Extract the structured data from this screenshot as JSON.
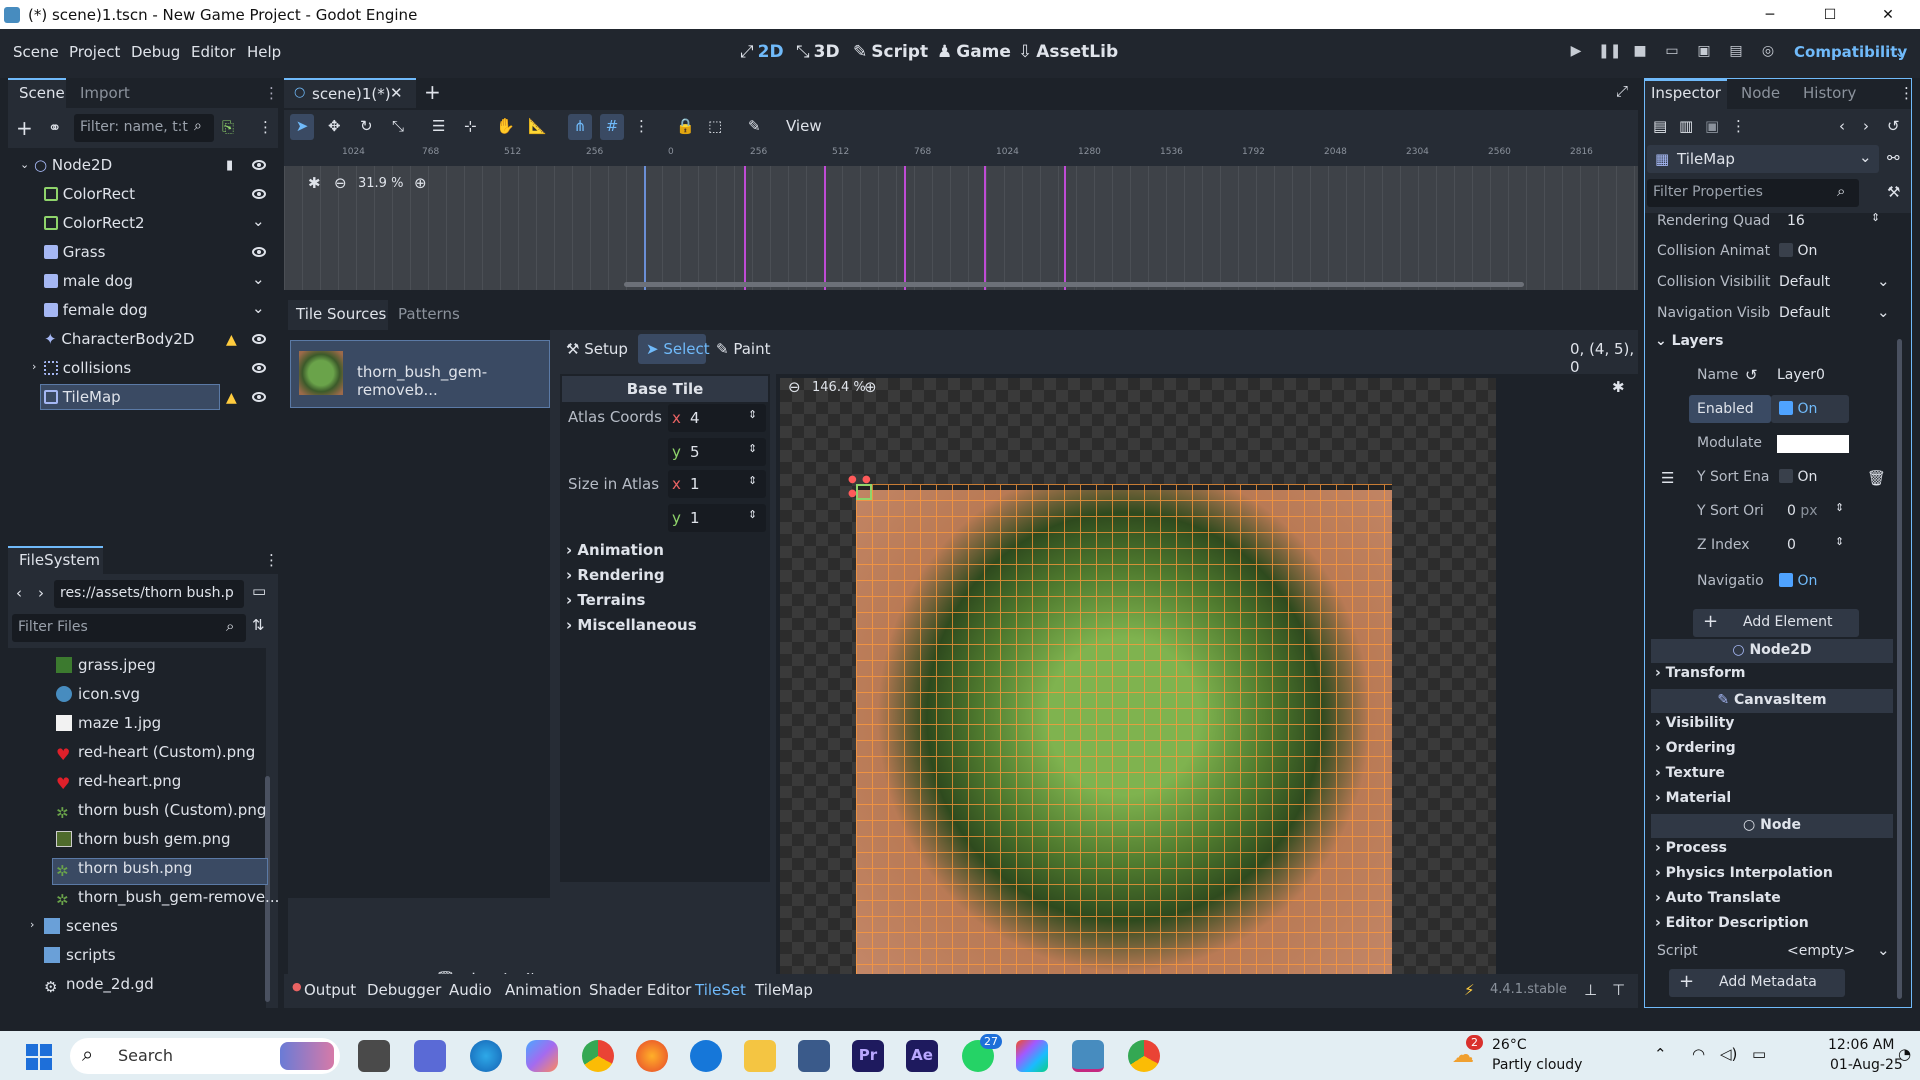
{
  "window": {
    "title": "(*) scene)1.tscn - New Game Project - Godot Engine",
    "minimize": "─",
    "maximize": "☐",
    "close": "✕"
  },
  "menu": {
    "items": [
      "Scene",
      "Project",
      "Debug",
      "Editor",
      "Help"
    ]
  },
  "workspaces": [
    {
      "label": "2D",
      "icon": "2d-icon",
      "active": true
    },
    {
      "label": "3D",
      "icon": "3d-icon",
      "active": false
    },
    {
      "label": "Script",
      "icon": "script-icon",
      "active": false
    },
    {
      "label": "Game",
      "icon": "game-icon",
      "active": false
    },
    {
      "label": "AssetLib",
      "icon": "assetlib-icon",
      "active": false
    }
  ],
  "renderer": "Compatibility",
  "scene_dock": {
    "tabs": [
      "Scene",
      "Import"
    ],
    "filter_placeholder": "Filter: name, t:t",
    "tree": [
      {
        "name": "Node2D",
        "icon": "node2d-icon"
      },
      {
        "name": "ColorRect",
        "icon": "colorrect-icon"
      },
      {
        "name": "ColorRect2",
        "icon": "colorrect-icon"
      },
      {
        "name": "Grass",
        "icon": "sprite-icon"
      },
      {
        "name": "male dog",
        "icon": "sprite-icon"
      },
      {
        "name": "female dog",
        "icon": "sprite-icon"
      },
      {
        "name": "CharacterBody2D",
        "icon": "characterbody-icon"
      },
      {
        "name": "collisions",
        "icon": "node2d-icon"
      },
      {
        "name": "TileMap",
        "icon": "tilemap-icon"
      }
    ]
  },
  "filesystem": {
    "tab": "FileSystem",
    "path": "res://assets/thorn bush.p",
    "filter_placeholder": "Filter Files",
    "items": [
      "grass.jpeg",
      "icon.svg",
      "maze 1.jpg",
      "red-heart (Custom).png",
      "red-heart.png",
      "thorn bush (Custom).png",
      "thorn bush gem.png",
      "thorn bush.png",
      "thorn_bush_gem-remove...",
      "scenes",
      "scripts",
      "node_2d.gd"
    ]
  },
  "editor": {
    "scene_tab": "scene)1(*)",
    "view_menu": "View",
    "zoom": "31.9 %",
    "ruler_ticks": [
      "1024",
      "768",
      "512",
      "256",
      "0",
      "256",
      "512",
      "768",
      "1024",
      "1280",
      "1536",
      "1792",
      "2048",
      "2304",
      "2560",
      "2816"
    ]
  },
  "tileset": {
    "tabs": [
      "Tile Sources",
      "Patterns"
    ],
    "source_name": "thorn_bush_gem-removeb...",
    "modes": [
      "Setup",
      "Select",
      "Paint"
    ],
    "coords": "0, (4, 5), 0",
    "atlas_zoom": "146.4 %",
    "base_tile": "Base Tile",
    "atlas_coords_label": "Atlas Coords",
    "atlas_x": "4",
    "atlas_y": "5",
    "size_label": "Size in Atlas",
    "size_x": "1",
    "size_y": "1",
    "axis_x": "x",
    "axis_y": "y",
    "sections": [
      "Animation",
      "Rendering",
      "Terrains",
      "Miscellaneous"
    ]
  },
  "bottom_bar": {
    "tabs": [
      "Output",
      "Debugger",
      "Audio",
      "Animation",
      "Shader Editor",
      "TileSet",
      "TileMap"
    ],
    "version": "4.4.1.stable"
  },
  "inspector": {
    "tabs": [
      "Inspector",
      "Node",
      "History"
    ],
    "object": "TileMap",
    "filter_placeholder": "Filter Properties",
    "props": [
      {
        "label": "Rendering Quad",
        "value": "16"
      },
      {
        "label": "Collision Animat",
        "value": "On"
      },
      {
        "label": "Collision Visibilit",
        "value": "Default"
      },
      {
        "label": "Navigation Visib",
        "value": "Default"
      }
    ],
    "layers_section": "Layers",
    "layer": {
      "name_label": "Name",
      "name_value": "Layer0",
      "enabled_label": "Enabled",
      "enabled_value": "On",
      "modulate_label": "Modulate",
      "ysort_label": "Y Sort Ena",
      "ysort_value": "On",
      "ysort_origin_label": "Y Sort Ori",
      "ysort_origin_value": "0",
      "ysort_origin_unit": "px",
      "zindex_label": "Z Index",
      "zindex_value": "0",
      "nav_label": "Navigatio",
      "nav_value": "On"
    },
    "add_element": "Add Element",
    "node2d_header": "Node2D",
    "transform": "Transform",
    "canvasitem_header": "CanvasItem",
    "canvas_sections": [
      "Visibility",
      "Ordering",
      "Texture",
      "Material"
    ],
    "node_header": "Node",
    "node_sections": [
      "Process",
      "Physics Interpolation",
      "Auto Translate",
      "Editor Description"
    ],
    "script_label": "Script",
    "script_value": "<empty>",
    "add_metadata": "Add Metadata"
  },
  "taskbar": {
    "search": "Search",
    "weather_temp": "26°C",
    "weather_desc": "Partly cloudy",
    "weather_badge": "2",
    "whatsapp_badge": "27",
    "time": "12:06 AM",
    "date": "01-Aug-25"
  },
  "colors": {
    "accent": "#70bafa",
    "selection": "#3a4a63",
    "warning": "#ffcc3e",
    "grid": "#ff9a3c"
  }
}
